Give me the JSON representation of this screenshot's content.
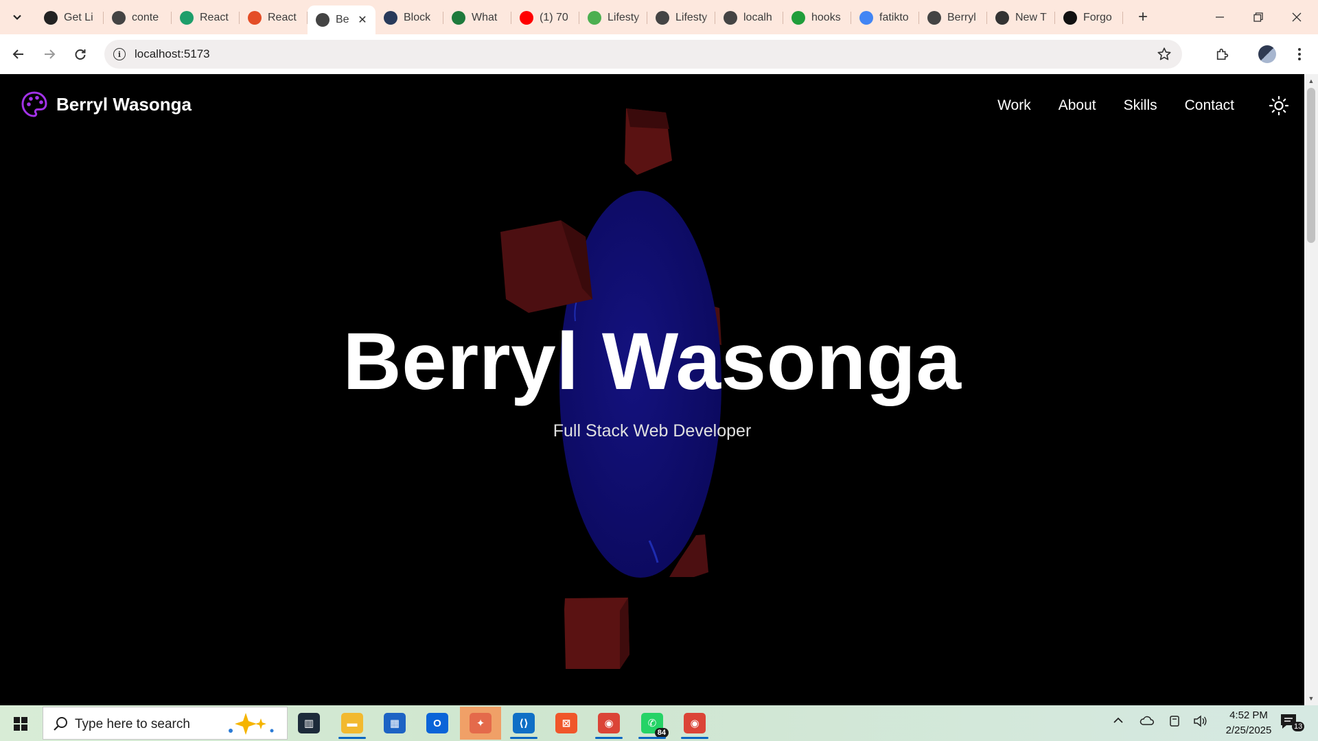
{
  "browser": {
    "tabs": [
      {
        "label": "Get Li",
        "icon": "openai-icon",
        "color": "#222222",
        "active": false
      },
      {
        "label": "conte",
        "icon": "globe-icon",
        "color": "#444444",
        "active": false
      },
      {
        "label": "React",
        "icon": "w-icon",
        "color": "#1e9e6a",
        "active": false
      },
      {
        "label": "React",
        "icon": "html5-icon",
        "color": "#e44d26",
        "active": false
      },
      {
        "label": "Be",
        "icon": "globe-icon",
        "color": "#444444",
        "active": true
      },
      {
        "label": "Block",
        "icon": "blockchain-icon",
        "color": "#283a5a",
        "active": false
      },
      {
        "label": "What",
        "icon": "infinity-icon",
        "color": "#1e7a3c",
        "active": false
      },
      {
        "label": "(1) 70",
        "icon": "youtube-icon",
        "color": "#ff0000",
        "active": false
      },
      {
        "label": "Lifesty",
        "icon": "leaf-icon",
        "color": "#4caf50",
        "active": false
      },
      {
        "label": "Lifesty",
        "icon": "globe-icon",
        "color": "#444444",
        "active": false
      },
      {
        "label": "localh",
        "icon": "globe-icon",
        "color": "#444444",
        "active": false
      },
      {
        "label": "hooks",
        "icon": "spreadsheet-icon",
        "color": "#1f9d3a",
        "active": false
      },
      {
        "label": "fatikto",
        "icon": "google-icon",
        "color": "#4285f4",
        "active": false
      },
      {
        "label": "Berryl",
        "icon": "globe-icon",
        "color": "#444444",
        "active": false
      },
      {
        "label": "New T",
        "icon": "chrome-icon",
        "color": "#333333",
        "active": false
      },
      {
        "label": "Forgo",
        "icon": "github-icon",
        "color": "#111111",
        "active": false
      }
    ],
    "url": "localhost:5173"
  },
  "site": {
    "brand": "Berryl Wasonga",
    "accent": "#a232e8",
    "nav": [
      {
        "label": "Work"
      },
      {
        "label": "About"
      },
      {
        "label": "Skills"
      },
      {
        "label": "Contact"
      }
    ],
    "hero_title": "Berryl Wasonga",
    "hero_subtitle": "Full Stack Web Developer",
    "scene_colors": {
      "cubes": "#5a1212",
      "ring": "#0d0b6b"
    }
  },
  "taskbar": {
    "search_placeholder": "Type here to search",
    "apps": [
      {
        "name": "task-view",
        "color": "#1d2b3a",
        "glyph": "▥"
      },
      {
        "name": "file-explorer",
        "color": "#f2b92f",
        "glyph": "▬",
        "running": true
      },
      {
        "name": "microsoft-store",
        "color": "#1d63c4",
        "glyph": "▦"
      },
      {
        "name": "outlook",
        "color": "#0a64d8",
        "glyph": "O"
      },
      {
        "name": "copilot",
        "color": "#e46a4b",
        "glyph": "✦",
        "highlight": true
      },
      {
        "name": "vs-code",
        "color": "#0f6fc6",
        "glyph": "⟨⟩",
        "running": true
      },
      {
        "name": "xampp",
        "color": "#f0562a",
        "glyph": "⊠"
      },
      {
        "name": "chrome",
        "color": "#db4437",
        "glyph": "◉",
        "running": true
      },
      {
        "name": "whatsapp",
        "color": "#25d366",
        "glyph": "✆",
        "badge": "84",
        "running": true
      },
      {
        "name": "chrome-alt",
        "color": "#db4437",
        "glyph": "◉",
        "running": true
      }
    ],
    "time": "4:52 PM",
    "date": "2/25/2025",
    "notifications": "13"
  }
}
